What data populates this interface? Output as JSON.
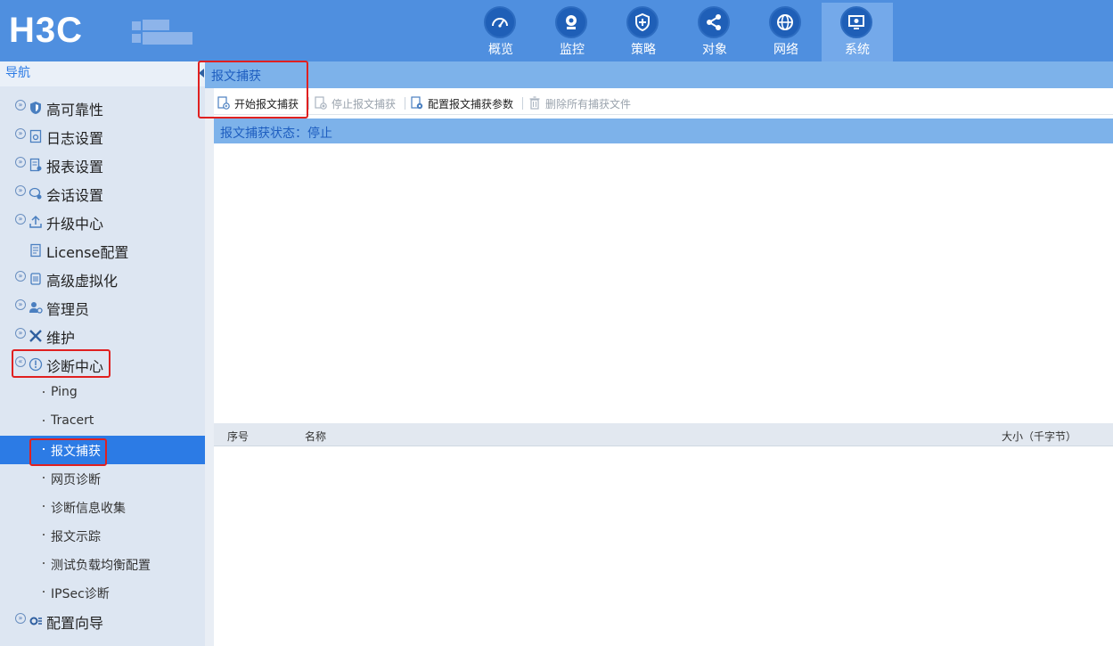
{
  "header": {
    "logo_text": "H3C",
    "nav_items": [
      {
        "label": "概览",
        "icon": "dashboard-icon"
      },
      {
        "label": "监控",
        "icon": "webcam-icon"
      },
      {
        "label": "策略",
        "icon": "shield-icon"
      },
      {
        "label": "对象",
        "icon": "share-icon"
      },
      {
        "label": "网络",
        "icon": "globe-icon"
      },
      {
        "label": "系统",
        "icon": "monitor-gear-icon",
        "active": true
      }
    ]
  },
  "sidebar": {
    "title": "导航",
    "items": [
      {
        "label": "高可靠性",
        "icon": "shield-icon"
      },
      {
        "label": "日志设置",
        "icon": "log-settings-icon"
      },
      {
        "label": "报表设置",
        "icon": "report-icon"
      },
      {
        "label": "会话设置",
        "icon": "session-icon"
      },
      {
        "label": "升级中心",
        "icon": "upload-icon"
      },
      {
        "label": "License配置",
        "icon": "license-icon"
      },
      {
        "label": "高级虚拟化",
        "icon": "virtualization-icon"
      },
      {
        "label": "管理员",
        "icon": "admin-icon"
      },
      {
        "label": "维护",
        "icon": "tools-icon"
      },
      {
        "label": "诊断中心",
        "icon": "diagnosis-icon",
        "expanded": true
      }
    ],
    "sub_items": [
      {
        "label": "Ping"
      },
      {
        "label": "Tracert"
      },
      {
        "label": "报文捕获",
        "active": true
      },
      {
        "label": "网页诊断"
      },
      {
        "label": "诊断信息收集"
      },
      {
        "label": "报文示踪"
      },
      {
        "label": "测试负载均衡配置"
      },
      {
        "label": "IPSec诊断"
      }
    ],
    "last_item": {
      "label": "配置向导",
      "icon": "wizard-icon"
    }
  },
  "main": {
    "tab_title": "报文捕获",
    "toolbar": {
      "start": "开始报文捕获",
      "stop": "停止报文捕获",
      "config": "配置报文捕获参数",
      "delete_all": "删除所有捕获文件"
    },
    "status": "报文捕获状态：停止",
    "table": {
      "columns": [
        "序号",
        "名称",
        "大小（千字节）"
      ]
    }
  },
  "colors": {
    "header_bg": "#4f8fdf",
    "nav_active": "#74a9ea",
    "sidebar_bg": "#dde6f2",
    "accent": "#2c7be5",
    "bar_bg": "#7db2ea",
    "highlight": "#e02020"
  }
}
